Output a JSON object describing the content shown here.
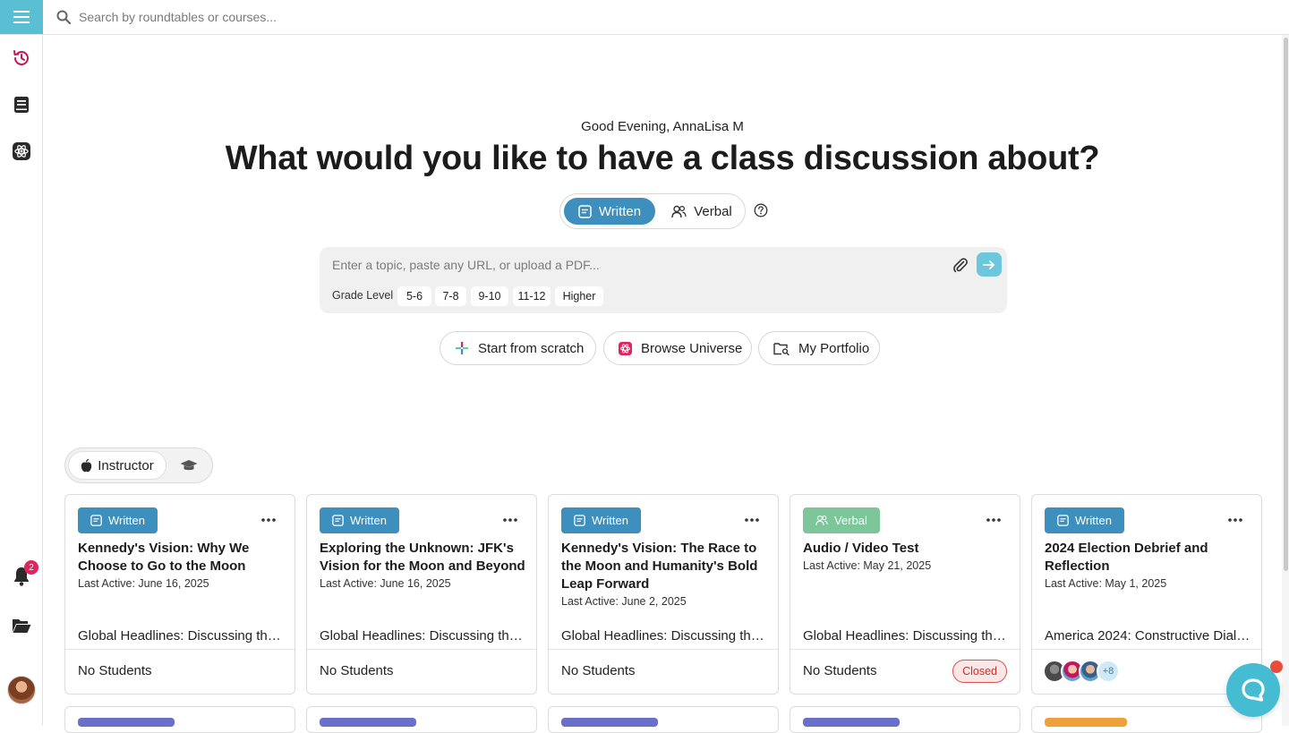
{
  "topbar": {
    "search_placeholder": "Search by roundtables or courses..."
  },
  "sidebar": {
    "items": [
      {
        "icon": "history-icon"
      },
      {
        "icon": "book-icon"
      },
      {
        "icon": "atom-icon"
      }
    ],
    "notifications": {
      "icon": "bell-icon",
      "count": "2"
    },
    "folder": {
      "icon": "folder-open-icon"
    }
  },
  "hero": {
    "greeting": "Good Evening, AnnaLisa M",
    "headline": "What would you like to have a class discussion about?",
    "modes": {
      "written": "Written",
      "verbal": "Verbal",
      "selected": "Written"
    }
  },
  "prompt": {
    "placeholder": "Enter a topic, paste any URL, or upload a PDF...",
    "grade_label": "Grade Level",
    "grades": [
      "5-6",
      "7-8",
      "9-10",
      "11-12",
      "Higher"
    ]
  },
  "actions": {
    "scratch": "Start from scratch",
    "universe": "Browse Universe",
    "portfolio": "My Portfolio"
  },
  "role": {
    "instructor": "Instructor",
    "selected": "Instructor"
  },
  "colors": {
    "accent": "#5bbfd4",
    "written": "#3d8fbd",
    "verbal": "#7cc69a",
    "closed": "#d9534f"
  },
  "cards": [
    {
      "type": "Written",
      "title": "Kennedy's Vision: Why We Choose to Go to the Moon",
      "last_active": "Last Active: June 16, 2025",
      "course": "Global Headlines: Discussing the ...",
      "students": "No Students"
    },
    {
      "type": "Written",
      "title": "Exploring the Unknown: JFK's Vision for the Moon and Beyond",
      "last_active": "Last Active: June 16, 2025",
      "course": "Global Headlines: Discussing the ...",
      "students": "No Students"
    },
    {
      "type": "Written",
      "title": "Kennedy's Vision: The Race to the Moon and Humanity's Bold Leap Forward",
      "last_active": "Last Active: June 2, 2025",
      "course": "Global Headlines: Discussing the ...",
      "students": "No Students"
    },
    {
      "type": "Verbal",
      "title": "Audio / Video Test",
      "last_active": "Last Active: May 21, 2025",
      "course": "Global Headlines: Discussing the ...",
      "students": "No Students",
      "status": "Closed"
    },
    {
      "type": "Written",
      "title": "2024 Election Debrief and Reflection",
      "last_active": "Last Active: May 1, 2025",
      "course": "America 2024: Constructive Dialo...",
      "extra_students": "+8"
    }
  ]
}
